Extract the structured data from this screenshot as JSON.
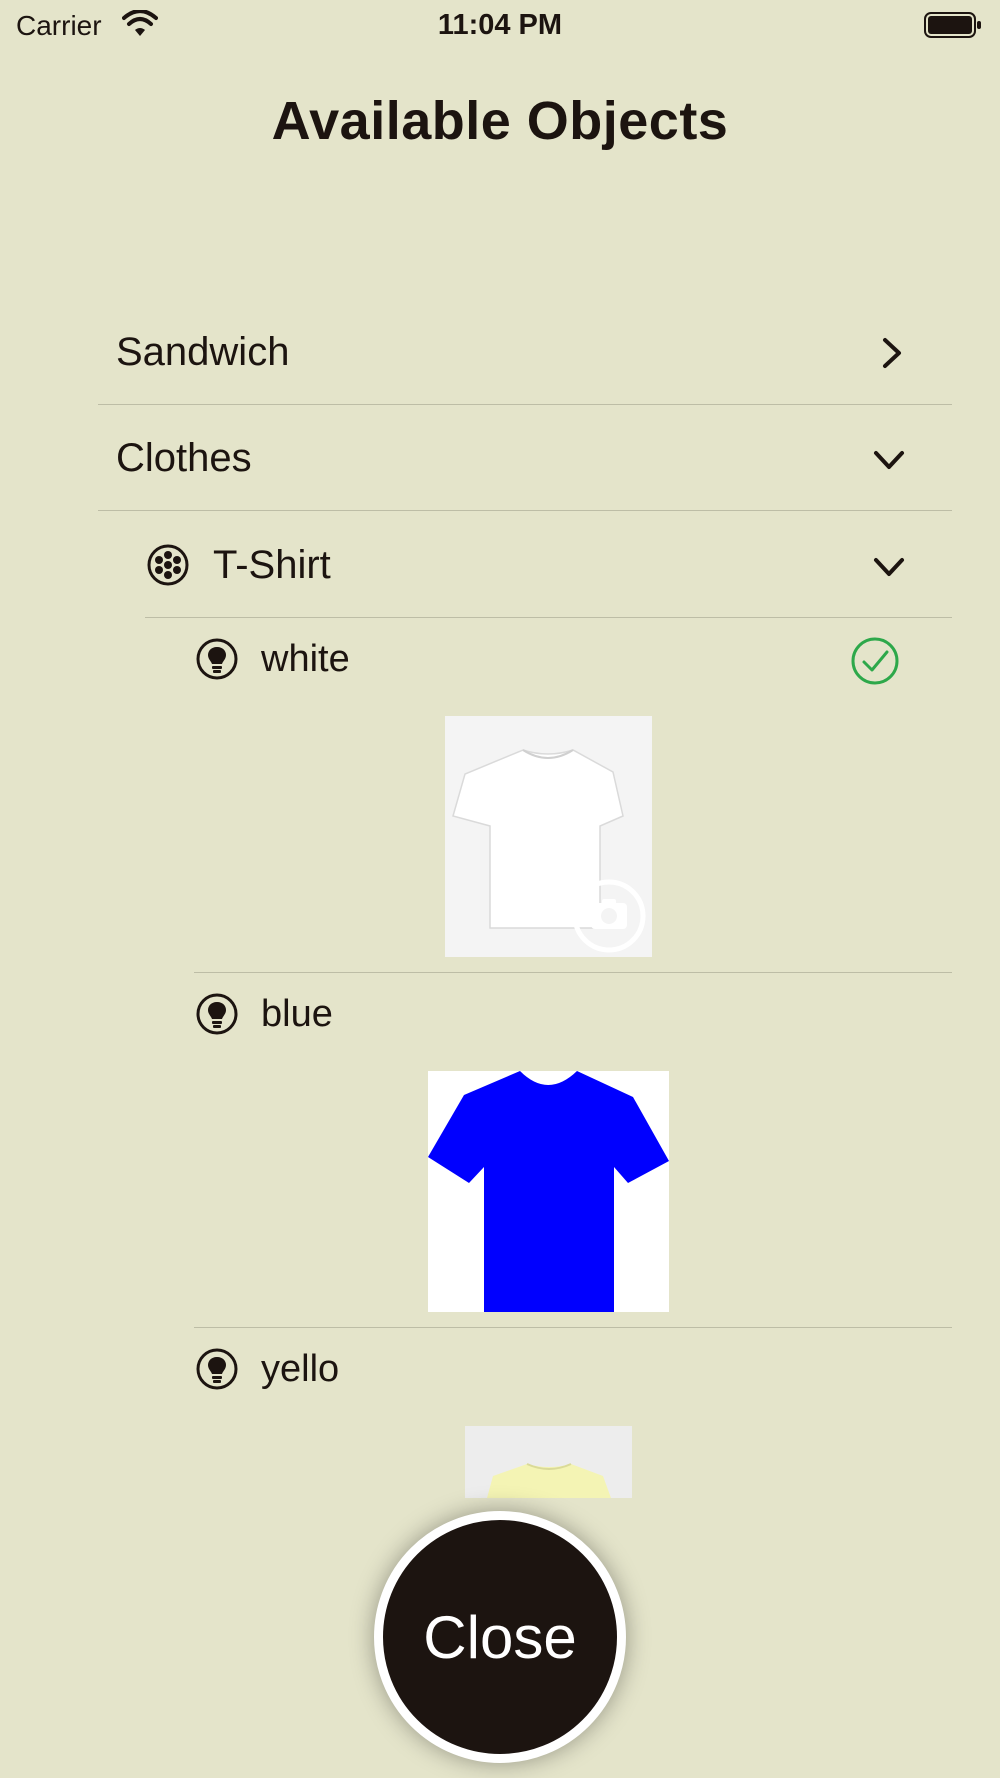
{
  "status_bar": {
    "carrier": "Carrier",
    "time": "11:04 PM"
  },
  "header": {
    "title": "Available Objects"
  },
  "list": {
    "categories": [
      {
        "label": "Sandwich",
        "state": "collapsed",
        "icon": "chevron-right-icon"
      },
      {
        "label": "Clothes",
        "state": "expanded",
        "icon": "chevron-down-icon"
      }
    ],
    "subcategory": {
      "label": "T-Shirt",
      "icon": "cluster-dots-icon",
      "state": "expanded"
    },
    "variants": [
      {
        "label": "white",
        "icon": "lightbulb-icon",
        "selected": true,
        "image": "white-tshirt-photo"
      },
      {
        "label": "blue",
        "icon": "lightbulb-icon",
        "selected": false,
        "image": "blue-tshirt-illustration"
      },
      {
        "label": "yello",
        "icon": "lightbulb-icon",
        "selected": false,
        "image": "yellow-tshirt-photo"
      }
    ]
  },
  "footer": {
    "close_label": "Close"
  },
  "colors": {
    "background": "#E4E4CA",
    "text": "#1C1410",
    "check_green": "#2DA84A",
    "blue_shirt": "#0000FF"
  }
}
